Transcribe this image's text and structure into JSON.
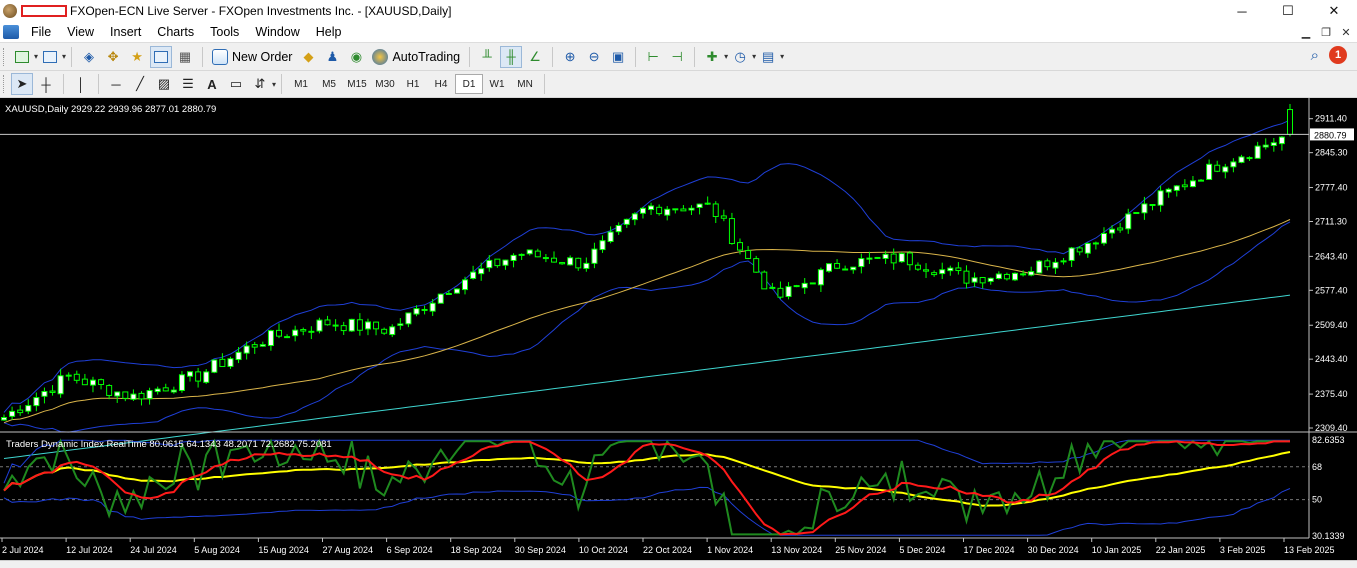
{
  "window": {
    "title": "FXOpen-ECN Live Server - FXOpen Investments Inc. - [XAUUSD,Daily]",
    "minimize_glyph": "─",
    "maximize_glyph": "☐",
    "close_glyph": "✕"
  },
  "menu": {
    "items": [
      "File",
      "View",
      "Insert",
      "Charts",
      "Tools",
      "Window",
      "Help"
    ]
  },
  "toolbar": {
    "new_order_label": "New Order",
    "autotrading_label": "AutoTrading",
    "notification_count": "1"
  },
  "timeframes": [
    "M1",
    "M5",
    "M15",
    "M30",
    "H1",
    "H4",
    "D1",
    "W1",
    "MN"
  ],
  "active_timeframe": "D1",
  "chart": {
    "header": "XAUUSD,Daily  2929.22 2939.96 2877.01 2880.79",
    "current_price_label": "2880.79",
    "price_ticks": [
      "2911.40",
      "2845.30",
      "2777.40",
      "2711.30",
      "2643.40",
      "2577.40",
      "2509.40",
      "2443.40",
      "2375.40",
      "2309.40"
    ],
    "indicator_header": "Traders Dynamic Index RealTime 80.0615 64.1343 48.2071 72.2682 75.2081",
    "indicator_ticks": [
      "82.6353",
      "68",
      "50",
      "30.1339"
    ],
    "date_ticks": [
      "2 Jul 2024",
      "12 Jul 2024",
      "24 Jul 2024",
      "5 Aug 2024",
      "15 Aug 2024",
      "27 Aug 2024",
      "6 Sep 2024",
      "18 Sep 2024",
      "30 Sep 2024",
      "10 Oct 2024",
      "22 Oct 2024",
      "1 Nov 2024",
      "13 Nov 2024",
      "25 Nov 2024",
      "5 Dec 2024",
      "17 Dec 2024",
      "30 Dec 2024",
      "10 Jan 2025",
      "22 Jan 2025",
      "3 Feb 2025",
      "13 Feb 2025"
    ],
    "colors": {
      "background": "#000000",
      "bull_candle": "#ffffff",
      "bear_candle": "#000000",
      "candle_wick": "#00ff00",
      "bollinger": "#1f3fd6",
      "ma_mid": "#d9b44a",
      "ma_long": "#3fd6d0",
      "tdi_rsi": "#1f8a1f",
      "tdi_signal": "#ff1a1a",
      "tdi_base": "#ffff00",
      "tdi_bands": "#1f3fd6"
    }
  },
  "chart_data": {
    "type": "candlestick",
    "symbol": "XAUUSD",
    "timeframe": "Daily",
    "last_bar": {
      "open": 2929.22,
      "high": 2939.96,
      "low": 2877.01,
      "close": 2880.79
    },
    "x": [
      "2 Jul 2024",
      "12 Jul 2024",
      "24 Jul 2024",
      "5 Aug 2024",
      "15 Aug 2024",
      "27 Aug 2024",
      "6 Sep 2024",
      "18 Sep 2024",
      "30 Sep 2024",
      "10 Oct 2024",
      "22 Oct 2024",
      "1 Nov 2024",
      "13 Nov 2024",
      "25 Nov 2024",
      "5 Dec 2024",
      "17 Dec 2024",
      "30 Dec 2024",
      "10 Jan 2025",
      "22 Jan 2025",
      "3 Feb 2025",
      "13 Feb 2025"
    ],
    "close_approx": [
      2330,
      2410,
      2370,
      2410,
      2480,
      2515,
      2500,
      2590,
      2650,
      2630,
      2740,
      2740,
      2560,
      2630,
      2640,
      2600,
      2620,
      2680,
      2760,
      2830,
      2880.79
    ],
    "ylim": [
      2309.4,
      2940
    ],
    "indicator": {
      "name": "Traders Dynamic Index RealTime",
      "values": [
        80.0615,
        64.1343,
        48.2071,
        72.2682,
        75.2081
      ],
      "ylim": [
        30.1339,
        82.6353
      ],
      "levels": [
        68,
        50
      ]
    }
  }
}
